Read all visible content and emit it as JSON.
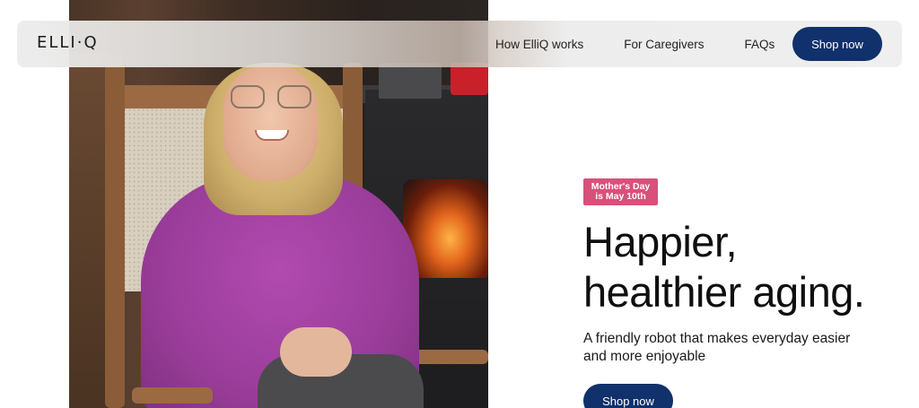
{
  "brand": {
    "logo_text": "ELLI·Q"
  },
  "nav": {
    "links": [
      {
        "label": "How ElliQ works"
      },
      {
        "label": "For Caregivers"
      },
      {
        "label": "FAQs"
      }
    ],
    "cta_label": "Shop now",
    "cta_color": "#10316b"
  },
  "hero": {
    "badge_line1": "Mother's Day",
    "badge_line2": "is May 10th",
    "badge_color": "#d9507a",
    "headline_line1": "Happier,",
    "headline_line2": "healthier aging.",
    "subtext": "A friendly robot that makes everyday easier and more enjoyable",
    "cta_label": "Shop now"
  }
}
